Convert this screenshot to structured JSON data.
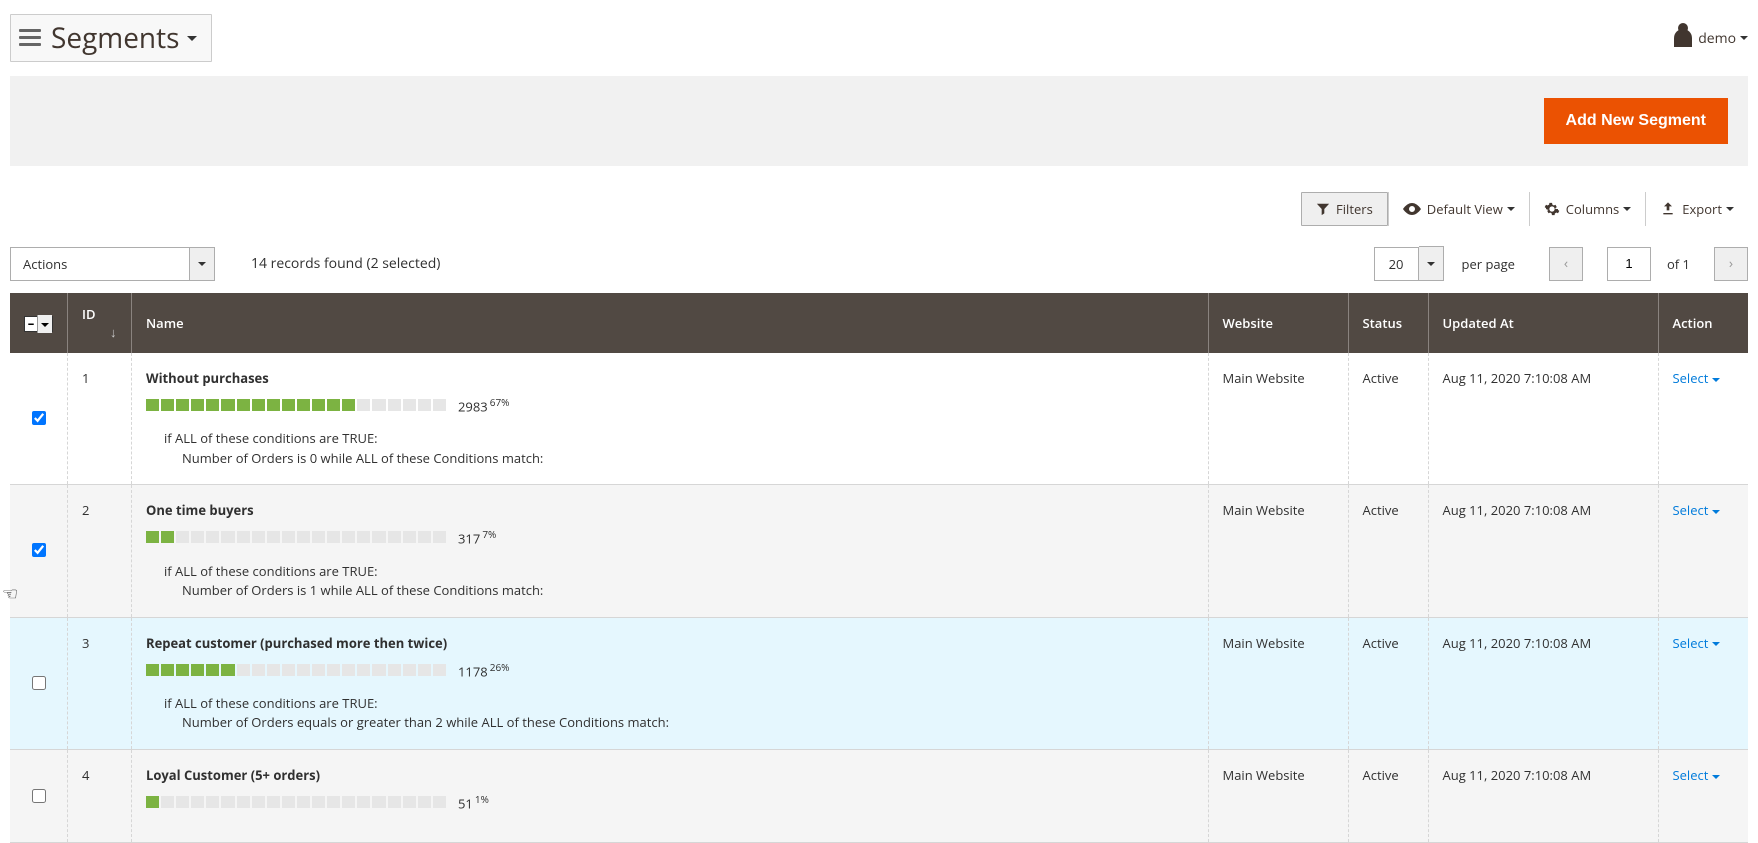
{
  "header": {
    "title": "Segments",
    "user": "demo"
  },
  "primary_action": "Add New Segment",
  "toolbar": {
    "filters": "Filters",
    "default_view": "Default View",
    "columns": "Columns",
    "export": "Export"
  },
  "controls": {
    "actions_label": "Actions",
    "records_found": "14 records found (2 selected)",
    "per_page_value": "20",
    "per_page_label": "per page",
    "page_current": "1",
    "page_total_label": "of 1"
  },
  "columns": {
    "id": "ID",
    "name": "Name",
    "website": "Website",
    "status": "Status",
    "updated_at": "Updated At",
    "action": "Action"
  },
  "action_select": "Select",
  "rows": [
    {
      "checked": true,
      "id": "1",
      "name": "Without purchases",
      "count": "2983",
      "pct": "67%",
      "fill20": 14,
      "cond_line1": "if ALL of these conditions are TRUE:",
      "cond_line2": "Number of Orders  is 0 while ALL of these Conditions match:",
      "website": "Main Website",
      "status": "Active",
      "updated": "Aug 11, 2020 7:10:08 AM"
    },
    {
      "checked": true,
      "id": "2",
      "name": "One time buyers",
      "count": "317",
      "pct": "7%",
      "fill20": 2,
      "cond_line1": "if ALL of these conditions are TRUE:",
      "cond_line2": "Number of Orders  is 1 while ALL of these Conditions match:",
      "website": "Main Website",
      "status": "Active",
      "updated": "Aug 11, 2020 7:10:08 AM"
    },
    {
      "checked": false,
      "id": "3",
      "name": "Repeat customer (purchased more then twice)",
      "count": "1178",
      "pct": "26%",
      "fill20": 6,
      "cond_line1": "if ALL of these conditions are TRUE:",
      "cond_line2": "Number of Orders  equals or greater than 2 while ALL of these Conditions match:",
      "website": "Main Website",
      "status": "Active",
      "updated": "Aug 11, 2020 7:10:08 AM"
    },
    {
      "checked": false,
      "id": "4",
      "name": "Loyal Customer (5+ orders)",
      "count": "51",
      "pct": "1%",
      "fill20": 1,
      "cond_line1": "",
      "cond_line2": "",
      "website": "Main Website",
      "status": "Active",
      "updated": "Aug 11, 2020 7:10:08 AM"
    }
  ]
}
